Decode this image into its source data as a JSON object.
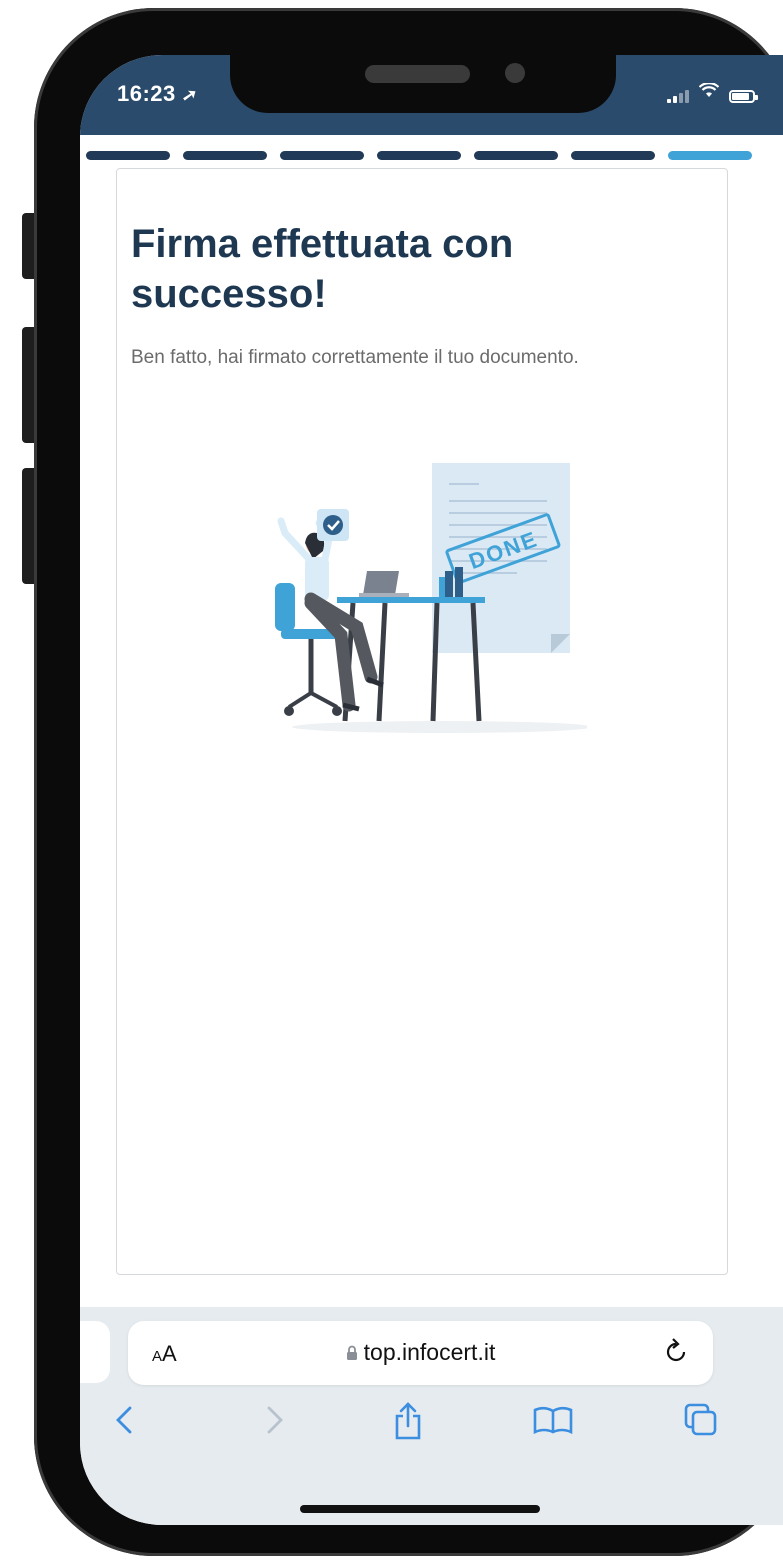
{
  "status_bar": {
    "time": "16:23"
  },
  "progress": {
    "total_steps": 7,
    "current_step": 7
  },
  "content": {
    "title": "Firma effettuata con successo!",
    "description": "Ben fatto, hai firmato correttamente il tuo documento.",
    "illustration_stamp": "DONE"
  },
  "browser": {
    "text_size_label_small": "A",
    "text_size_label_large": "A",
    "url": "top.infocert.it"
  },
  "colors": {
    "header": "#2a4b6c",
    "title": "#1f3852",
    "progress_done": "#203a58",
    "progress_active": "#3fa3d8",
    "browser_bar": "#e6ebef",
    "toolbar_icons": "#3b8ee0"
  },
  "icons": [
    "location-arrow-icon",
    "signal-icon",
    "wifi-icon",
    "battery-icon",
    "lock-icon",
    "reload-icon",
    "back-icon",
    "forward-icon",
    "share-icon",
    "bookmarks-icon",
    "tabs-icon"
  ]
}
